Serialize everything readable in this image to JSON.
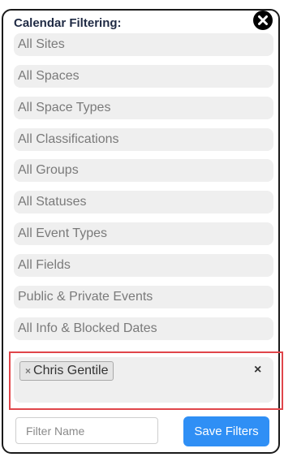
{
  "panel": {
    "title": "Calendar Filtering:",
    "close_icon": "close-circle-icon"
  },
  "filters": [
    {
      "key": "sites",
      "label": "All Sites"
    },
    {
      "key": "spaces",
      "label": "All Spaces"
    },
    {
      "key": "space_types",
      "label": "All Space Types"
    },
    {
      "key": "classifications",
      "label": "All Classifications"
    },
    {
      "key": "groups",
      "label": "All Groups"
    },
    {
      "key": "statuses",
      "label": "All Statuses"
    },
    {
      "key": "event_types",
      "label": "All Event Types"
    },
    {
      "key": "fields",
      "label": "All Fields"
    },
    {
      "key": "visibility",
      "label": "Public & Private Events"
    },
    {
      "key": "info_blocked",
      "label": "All Info & Blocked Dates"
    }
  ],
  "user_filter": {
    "selected": [
      {
        "remove_symbol": "×",
        "label": "Chris Gentile"
      }
    ],
    "clear_symbol": "×",
    "highlight_color": "#e0454a"
  },
  "footer": {
    "filter_name_value": "",
    "filter_name_placeholder": "Filter Name",
    "save_label": "Save Filters",
    "save_color": "#2f8ff5"
  }
}
